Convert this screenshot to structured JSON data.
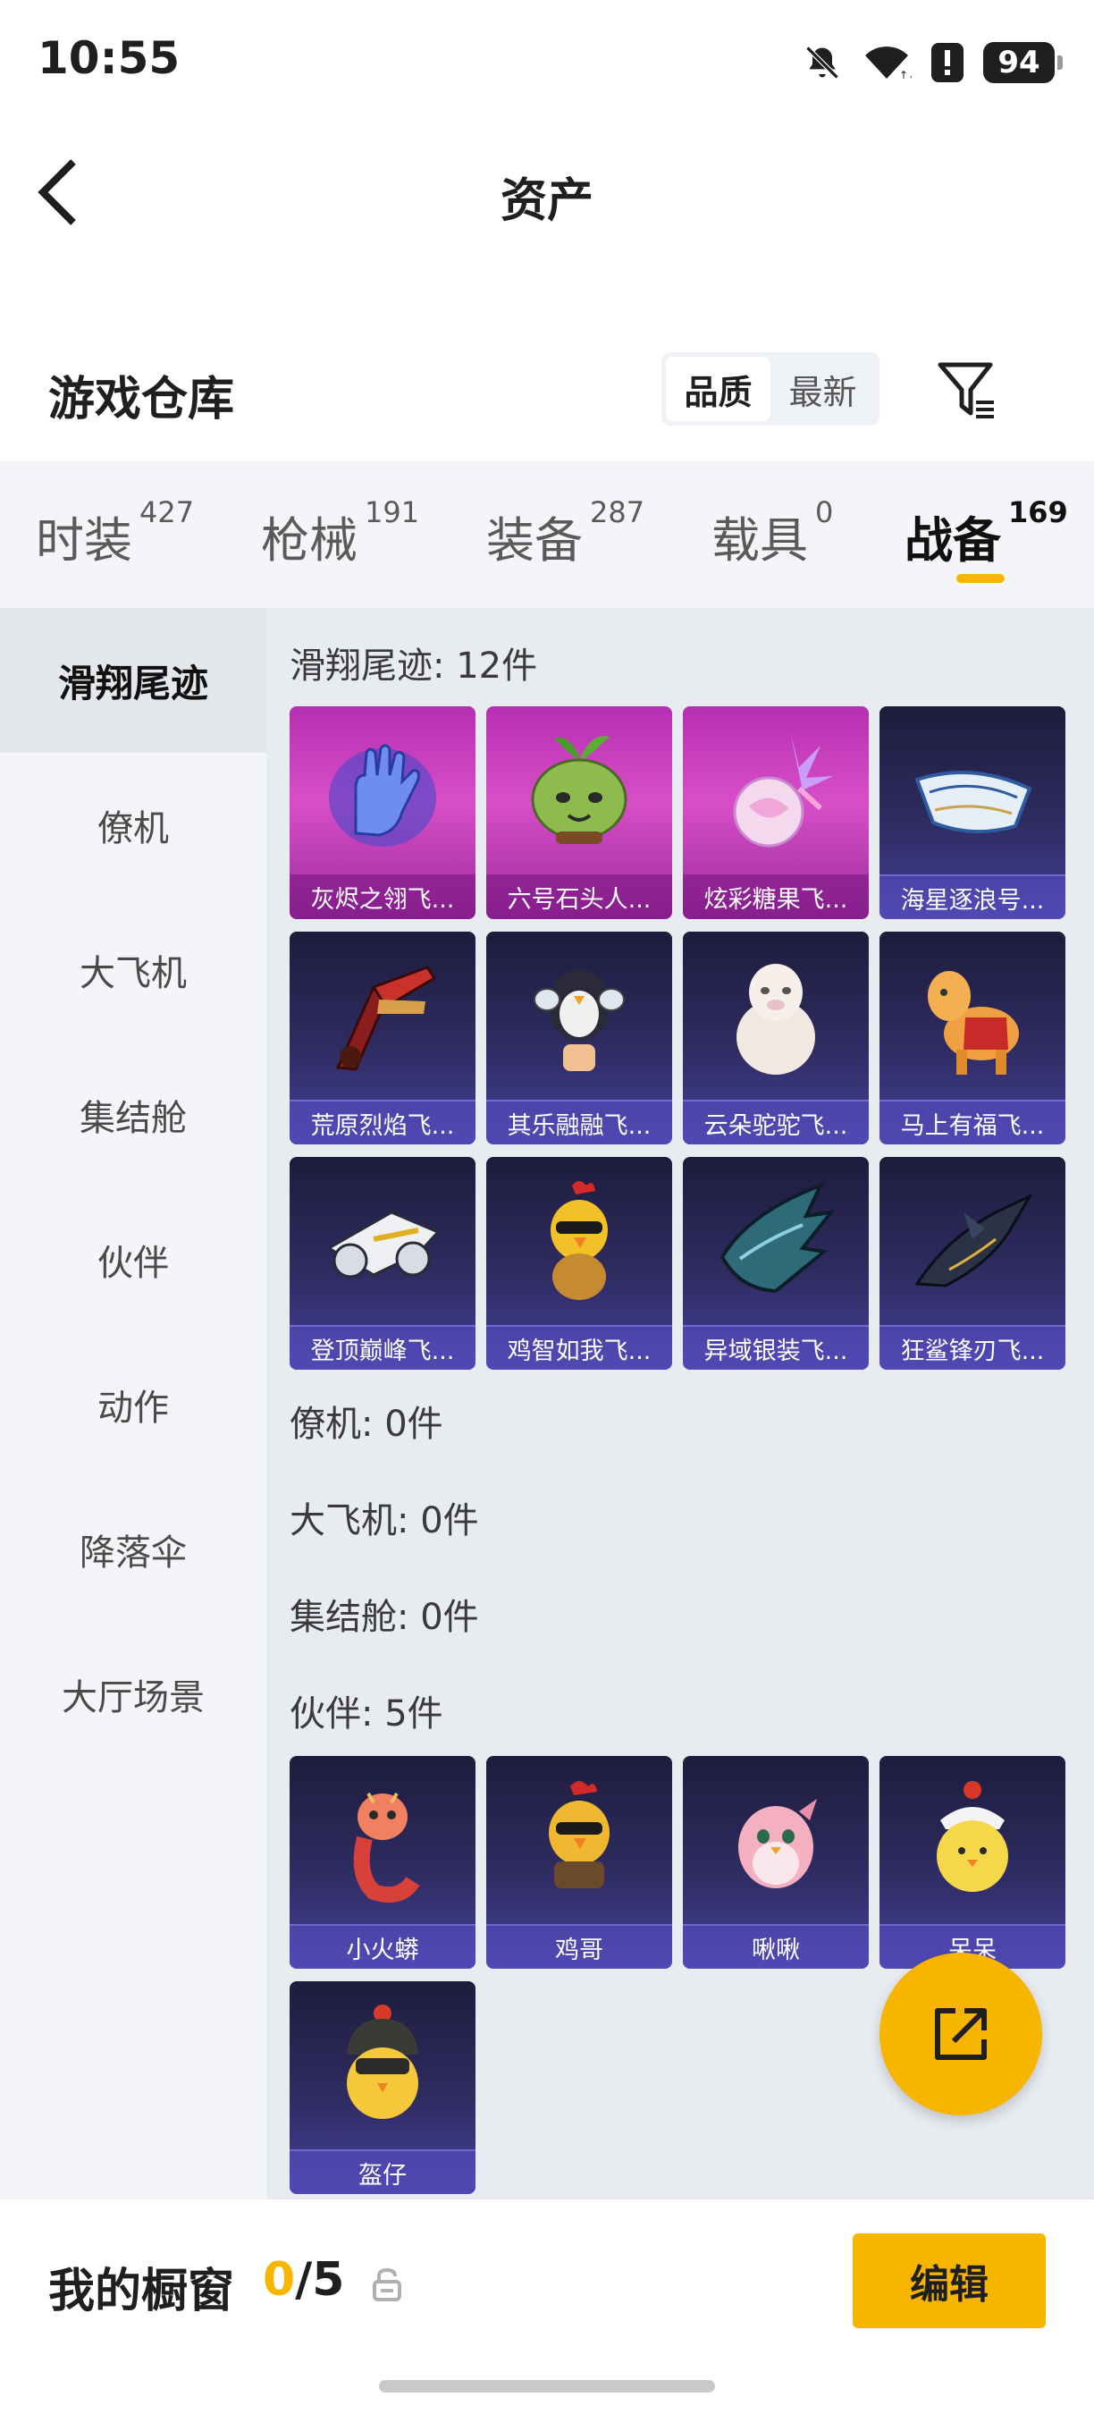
{
  "status_bar": {
    "time": "10:55",
    "battery": "94",
    "icons": [
      "bell-off-icon",
      "wifi-icon",
      "alert-icon",
      "battery-icon"
    ]
  },
  "header": {
    "title": "资产",
    "back_icon": "chevron-left-icon"
  },
  "warehouse": {
    "title": "游戏仓库",
    "sort_options": [
      {
        "label": "品质",
        "active": true
      },
      {
        "label": "最新",
        "active": false
      }
    ],
    "filter_icon": "filter-icon"
  },
  "category_tabs": [
    {
      "label": "时装",
      "count": "427",
      "active": false
    },
    {
      "label": "枪械",
      "count": "191",
      "active": false
    },
    {
      "label": "装备",
      "count": "287",
      "active": false
    },
    {
      "label": "载具",
      "count": "0",
      "active": false
    },
    {
      "label": "战备",
      "count": "169",
      "active": true
    }
  ],
  "sidebar": {
    "items": [
      {
        "label": "滑翔尾迹",
        "active": true
      },
      {
        "label": "僚机",
        "active": false
      },
      {
        "label": "大飞机",
        "active": false
      },
      {
        "label": "集结舱",
        "active": false
      },
      {
        "label": "伙伴",
        "active": false
      },
      {
        "label": "动作",
        "active": false
      },
      {
        "label": "降落伞",
        "active": false
      },
      {
        "label": "大厅场景",
        "active": false
      }
    ]
  },
  "sections": {
    "glide_trail": {
      "title": "滑翔尾迹: 12件",
      "items": [
        {
          "name": "灰烬之翎飞...",
          "rarity": "purple",
          "icon": "glove-icon"
        },
        {
          "name": "六号石头人...",
          "rarity": "purple",
          "icon": "sprout-creature-icon"
        },
        {
          "name": "炫彩糖果飞...",
          "rarity": "purple",
          "icon": "candy-icon"
        },
        {
          "name": "海星逐浪号...",
          "rarity": "blue",
          "icon": "boat-icon"
        },
        {
          "name": "荒原烈焰飞...",
          "rarity": "blue",
          "icon": "flame-glider-icon"
        },
        {
          "name": "其乐融融飞...",
          "rarity": "blue",
          "icon": "penguin-icon"
        },
        {
          "name": "云朵驼驼飞...",
          "rarity": "blue",
          "icon": "alpaca-icon"
        },
        {
          "name": "马上有福飞...",
          "rarity": "blue",
          "icon": "horse-icon"
        },
        {
          "name": "登顶巅峰飞...",
          "rarity": "blue",
          "icon": "jet-icon"
        },
        {
          "name": "鸡智如我飞...",
          "rarity": "blue",
          "icon": "chicken-icon"
        },
        {
          "name": "异域银装飞...",
          "rarity": "blue",
          "icon": "wing-icon"
        },
        {
          "name": "狂鲨锋刃飞...",
          "rarity": "blue",
          "icon": "shark-icon"
        }
      ]
    },
    "wingman": {
      "title": "僚机: 0件"
    },
    "big_plane": {
      "title": "大飞机: 0件"
    },
    "assembly_pod": {
      "title": "集结舱: 0件"
    },
    "partner": {
      "title": "伙伴: 5件",
      "items": [
        {
          "name": "小火蟒",
          "rarity": "blue",
          "icon": "dragon-icon"
        },
        {
          "name": "鸡哥",
          "rarity": "blue",
          "icon": "rooster-icon"
        },
        {
          "name": "啾啾",
          "rarity": "blue",
          "icon": "pink-bird-icon"
        },
        {
          "name": "呆呆",
          "rarity": "blue",
          "icon": "yellow-chick-icon"
        },
        {
          "name": "盔仔",
          "rarity": "blue",
          "icon": "helmet-chick-icon"
        }
      ]
    }
  },
  "fab": {
    "icon": "share-icon"
  },
  "showcase": {
    "title": "我的橱窗",
    "current": "0",
    "separator": "/",
    "max": "5",
    "lock_icon": "lock-icon",
    "edit_label": "编辑"
  },
  "colors": {
    "accent": "#f7b500",
    "purple_rarity": "#b52fb2",
    "blue_rarity": "#2f2c62"
  }
}
